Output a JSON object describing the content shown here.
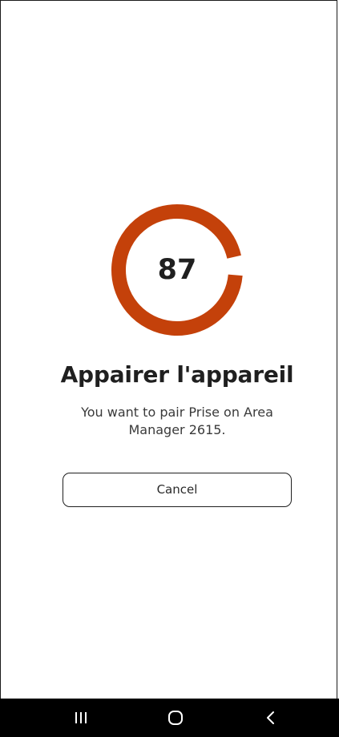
{
  "pairing": {
    "countdown": "87",
    "countdown_fraction": 0.95,
    "ring_color": "#C4410A",
    "title": "Appairer l'appareil",
    "description": "You want to pair Prise on Area Manager 2615.",
    "cancel_label": "Cancel"
  },
  "nav_bar": {
    "recent_icon": "recent-apps-icon",
    "home_icon": "home-icon",
    "back_icon": "back-icon"
  }
}
